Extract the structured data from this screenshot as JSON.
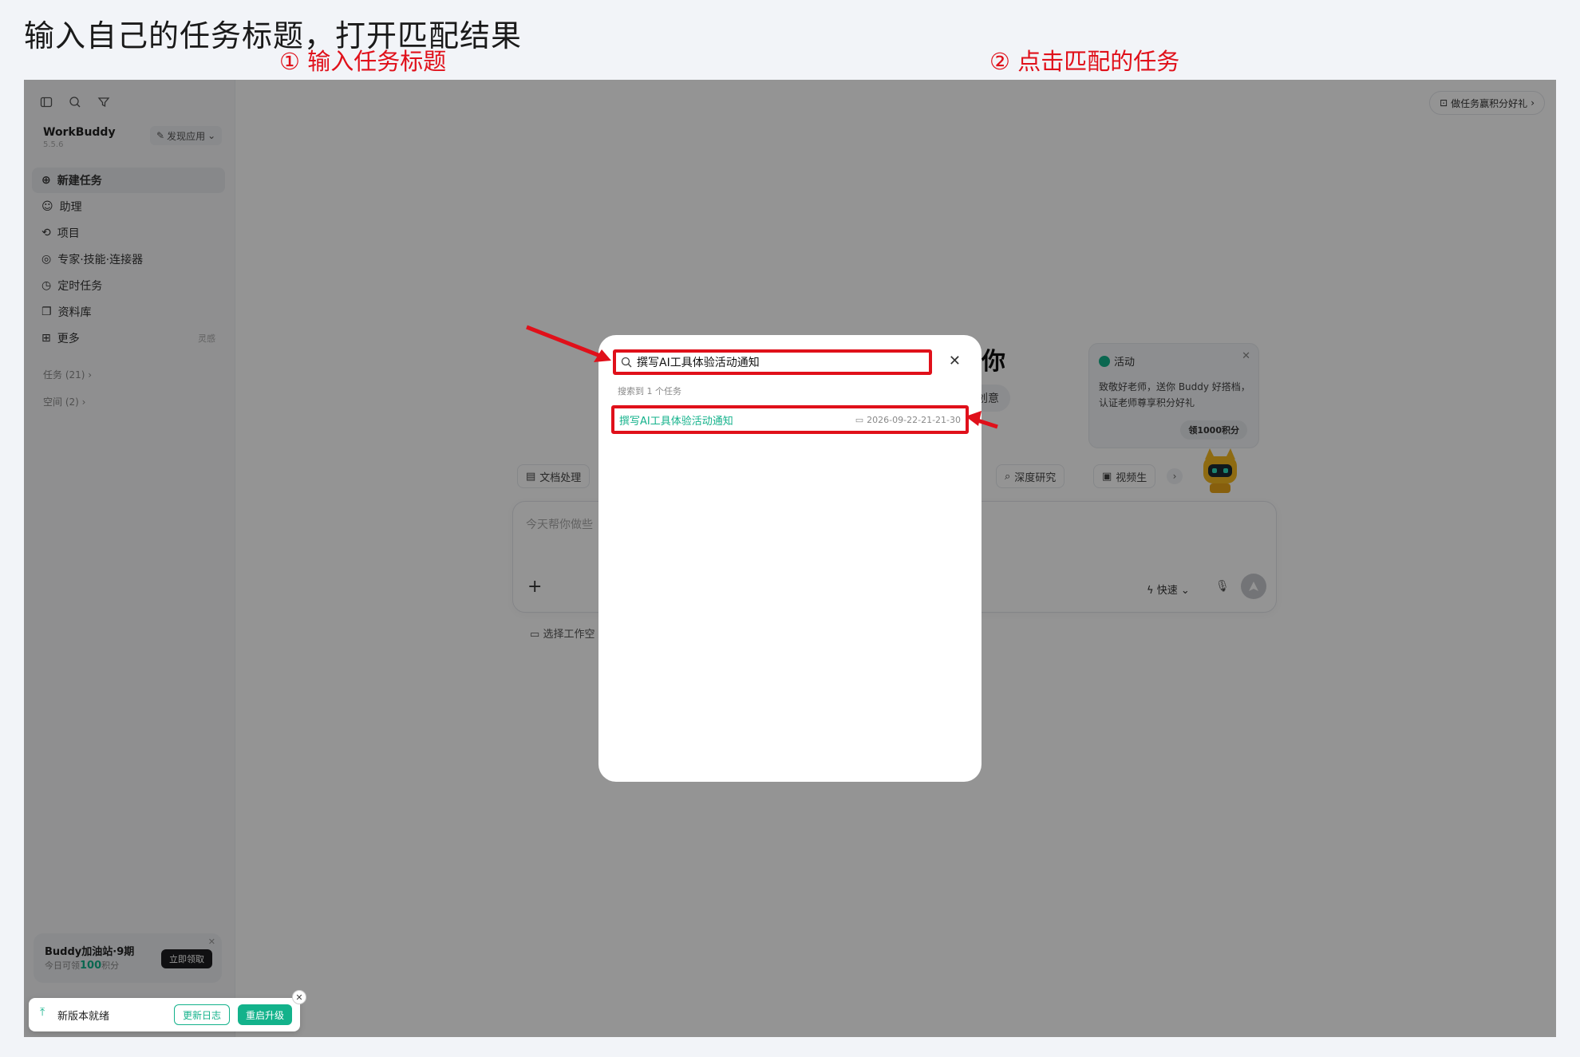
{
  "heading": "输入自己的任务标题，打开匹配结果",
  "steps": [
    "① 输入任务标题",
    "② 点击匹配的任务"
  ],
  "sidebar": {
    "brand": "WorkBuddy",
    "version": "5.5.6",
    "discover": "发现应用",
    "nav": [
      {
        "label": "新建任务",
        "icon": "plus-circle-icon"
      },
      {
        "label": "助理",
        "icon": "assistant-icon"
      },
      {
        "label": "项目",
        "icon": "project-icon"
      },
      {
        "label": "专家·技能·连接器",
        "icon": "expert-icon"
      },
      {
        "label": "定时任务",
        "icon": "clock-icon"
      },
      {
        "label": "资料库",
        "icon": "book-icon"
      },
      {
        "label": "更多",
        "icon": "grid-icon",
        "badge": "灵感"
      }
    ],
    "groups": [
      "任务 (21)",
      "空间 (2)"
    ],
    "promo": {
      "title": "Buddy加油站·9期",
      "sub_prefix": "今日可领",
      "sub_amount": "100",
      "sub_suffix": "积分",
      "button": "立即领取"
    },
    "update": {
      "text": "新版本就绪",
      "log": "更新日志",
      "upgrade": "重启升级"
    }
  },
  "main": {
    "top_badge": "做任务赢积分好礼",
    "greeting_tail": "你",
    "creative_chip": "创意",
    "activity": {
      "title": "活动",
      "body": "致敬好老师，送你 Buddy 好搭档，认证老师尊享积分好礼",
      "button": "领1000积分"
    },
    "chips": {
      "doc": "文档处理",
      "research": "深度研究",
      "video": "视频生"
    },
    "chat": {
      "placeholder": "今天帮你做些",
      "speed": "快速",
      "workspace": "选择工作空"
    }
  },
  "modal": {
    "search_value": "撰写AI工具体验活动通知",
    "found": "搜索到 1 个任务",
    "result": {
      "title": "撰写AI工具体验活动通知",
      "date": "2026-09-22-21-21-30"
    }
  },
  "colors": {
    "accent_green": "#13b28b",
    "annotation_red": "#e0101a"
  }
}
